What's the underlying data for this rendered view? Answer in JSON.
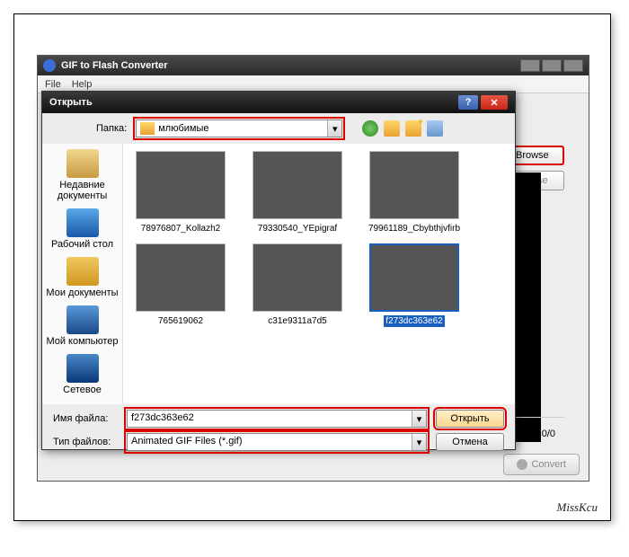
{
  "app": {
    "title": "GIF to Flash Converter",
    "menu": {
      "file": "File",
      "help": "Help"
    }
  },
  "right": {
    "browse1": "Browse",
    "browse2": "Browse"
  },
  "bottom": {
    "progress": "0/0",
    "convert": "Convert"
  },
  "dialog": {
    "title": "Открыть",
    "folder_label": "Папка:",
    "folder_value": "млюбимые",
    "places": {
      "recent": "Недавние документы",
      "desktop": "Рабочий стол",
      "mydocs": "Мои документы",
      "mycomp": "Мой компьютер",
      "network": "Сетевое"
    },
    "files": [
      {
        "name": "78976807_Kollazh2"
      },
      {
        "name": "79330540_YEpigraf"
      },
      {
        "name": "79961189_Cbybthjvfirb"
      },
      {
        "name": "765619062"
      },
      {
        "name": "c31e9311a7d5"
      },
      {
        "name": "f273dc363e62"
      }
    ],
    "filename_label": "Имя файла:",
    "filename_value": "f273dc363e62",
    "filetype_label": "Тип файлов:",
    "filetype_value": "Animated GIF Files (*.gif)",
    "open_btn": "Открыть",
    "cancel_btn": "Отмена"
  },
  "watermark": "MissKcu"
}
